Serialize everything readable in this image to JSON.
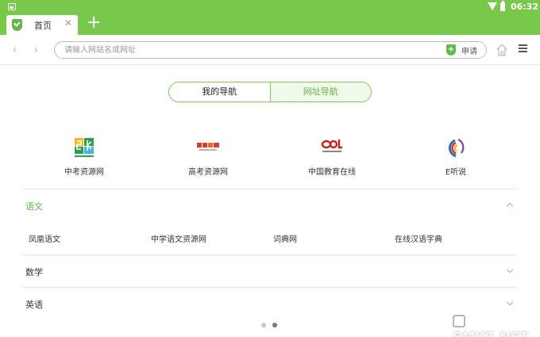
{
  "status_bar": {
    "time": "06:32"
  },
  "tab": {
    "title": "首页",
    "close": "✕",
    "new_tab": "+"
  },
  "toolbar": {
    "back": "‹",
    "forward": "›",
    "url_placeholder": "请输入网站名或网址",
    "shield_glyph": "+",
    "apply_label": "申请"
  },
  "segment": {
    "mine": "我的导航",
    "site": "网址导航"
  },
  "quick_links": [
    {
      "label": "中考资源网"
    },
    {
      "label": "高考资源网"
    },
    {
      "label": "中国教育在线"
    },
    {
      "label": "E听说"
    }
  ],
  "sections": {
    "chinese": {
      "title": "语文",
      "links": [
        "凤凰语文",
        "中学语文资源网",
        "词典网",
        "在线汉语字典"
      ]
    },
    "math": {
      "title": "数学"
    },
    "english": {
      "title": "英语"
    }
  },
  "watermark": "SMYZ.NET",
  "colors": {
    "brand_green": "#77c84b",
    "accent_text": "#5fb548"
  }
}
